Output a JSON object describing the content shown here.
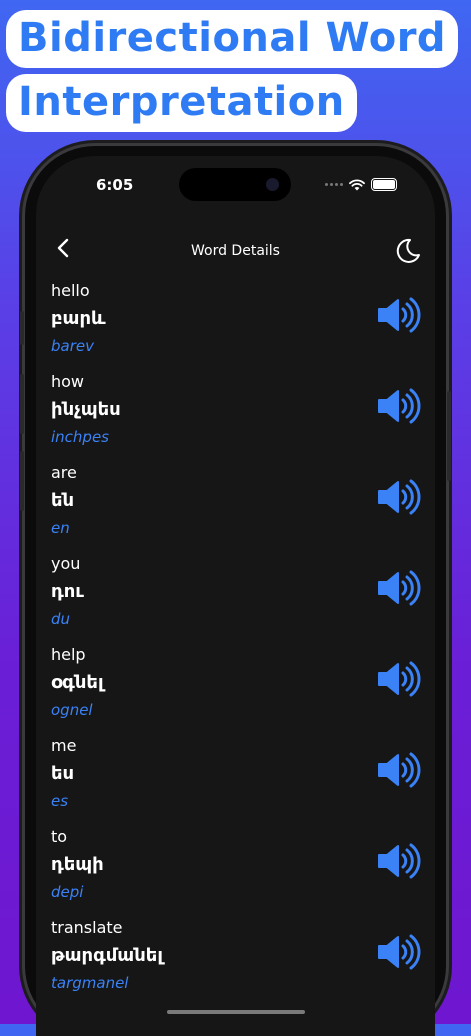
{
  "headline": {
    "line1": "Bidirectional Word",
    "line2": "Interpretation"
  },
  "status_bar": {
    "time": "6:05"
  },
  "nav": {
    "title": "Word Details",
    "back_icon": "chevron-left-icon",
    "theme_icon": "moon-icon"
  },
  "colors": {
    "accent": "#3a82f6",
    "background": "#161616",
    "headline_text": "#2f7bf3"
  },
  "words": [
    {
      "english": "hello",
      "armenian": "բարև",
      "transliteration": "barev"
    },
    {
      "english": "how",
      "armenian": "ինչպես",
      "transliteration": "inchpes"
    },
    {
      "english": "are",
      "armenian": "են",
      "transliteration": "en"
    },
    {
      "english": "you",
      "armenian": "դու",
      "transliteration": "du"
    },
    {
      "english": "help",
      "armenian": "օգնել",
      "transliteration": "ognel"
    },
    {
      "english": "me",
      "armenian": "ես",
      "transliteration": "es"
    },
    {
      "english": "to",
      "armenian": "դեպի",
      "transliteration": "depi"
    },
    {
      "english": "translate",
      "armenian": "թարգմանել",
      "transliteration": "targmanel"
    }
  ]
}
